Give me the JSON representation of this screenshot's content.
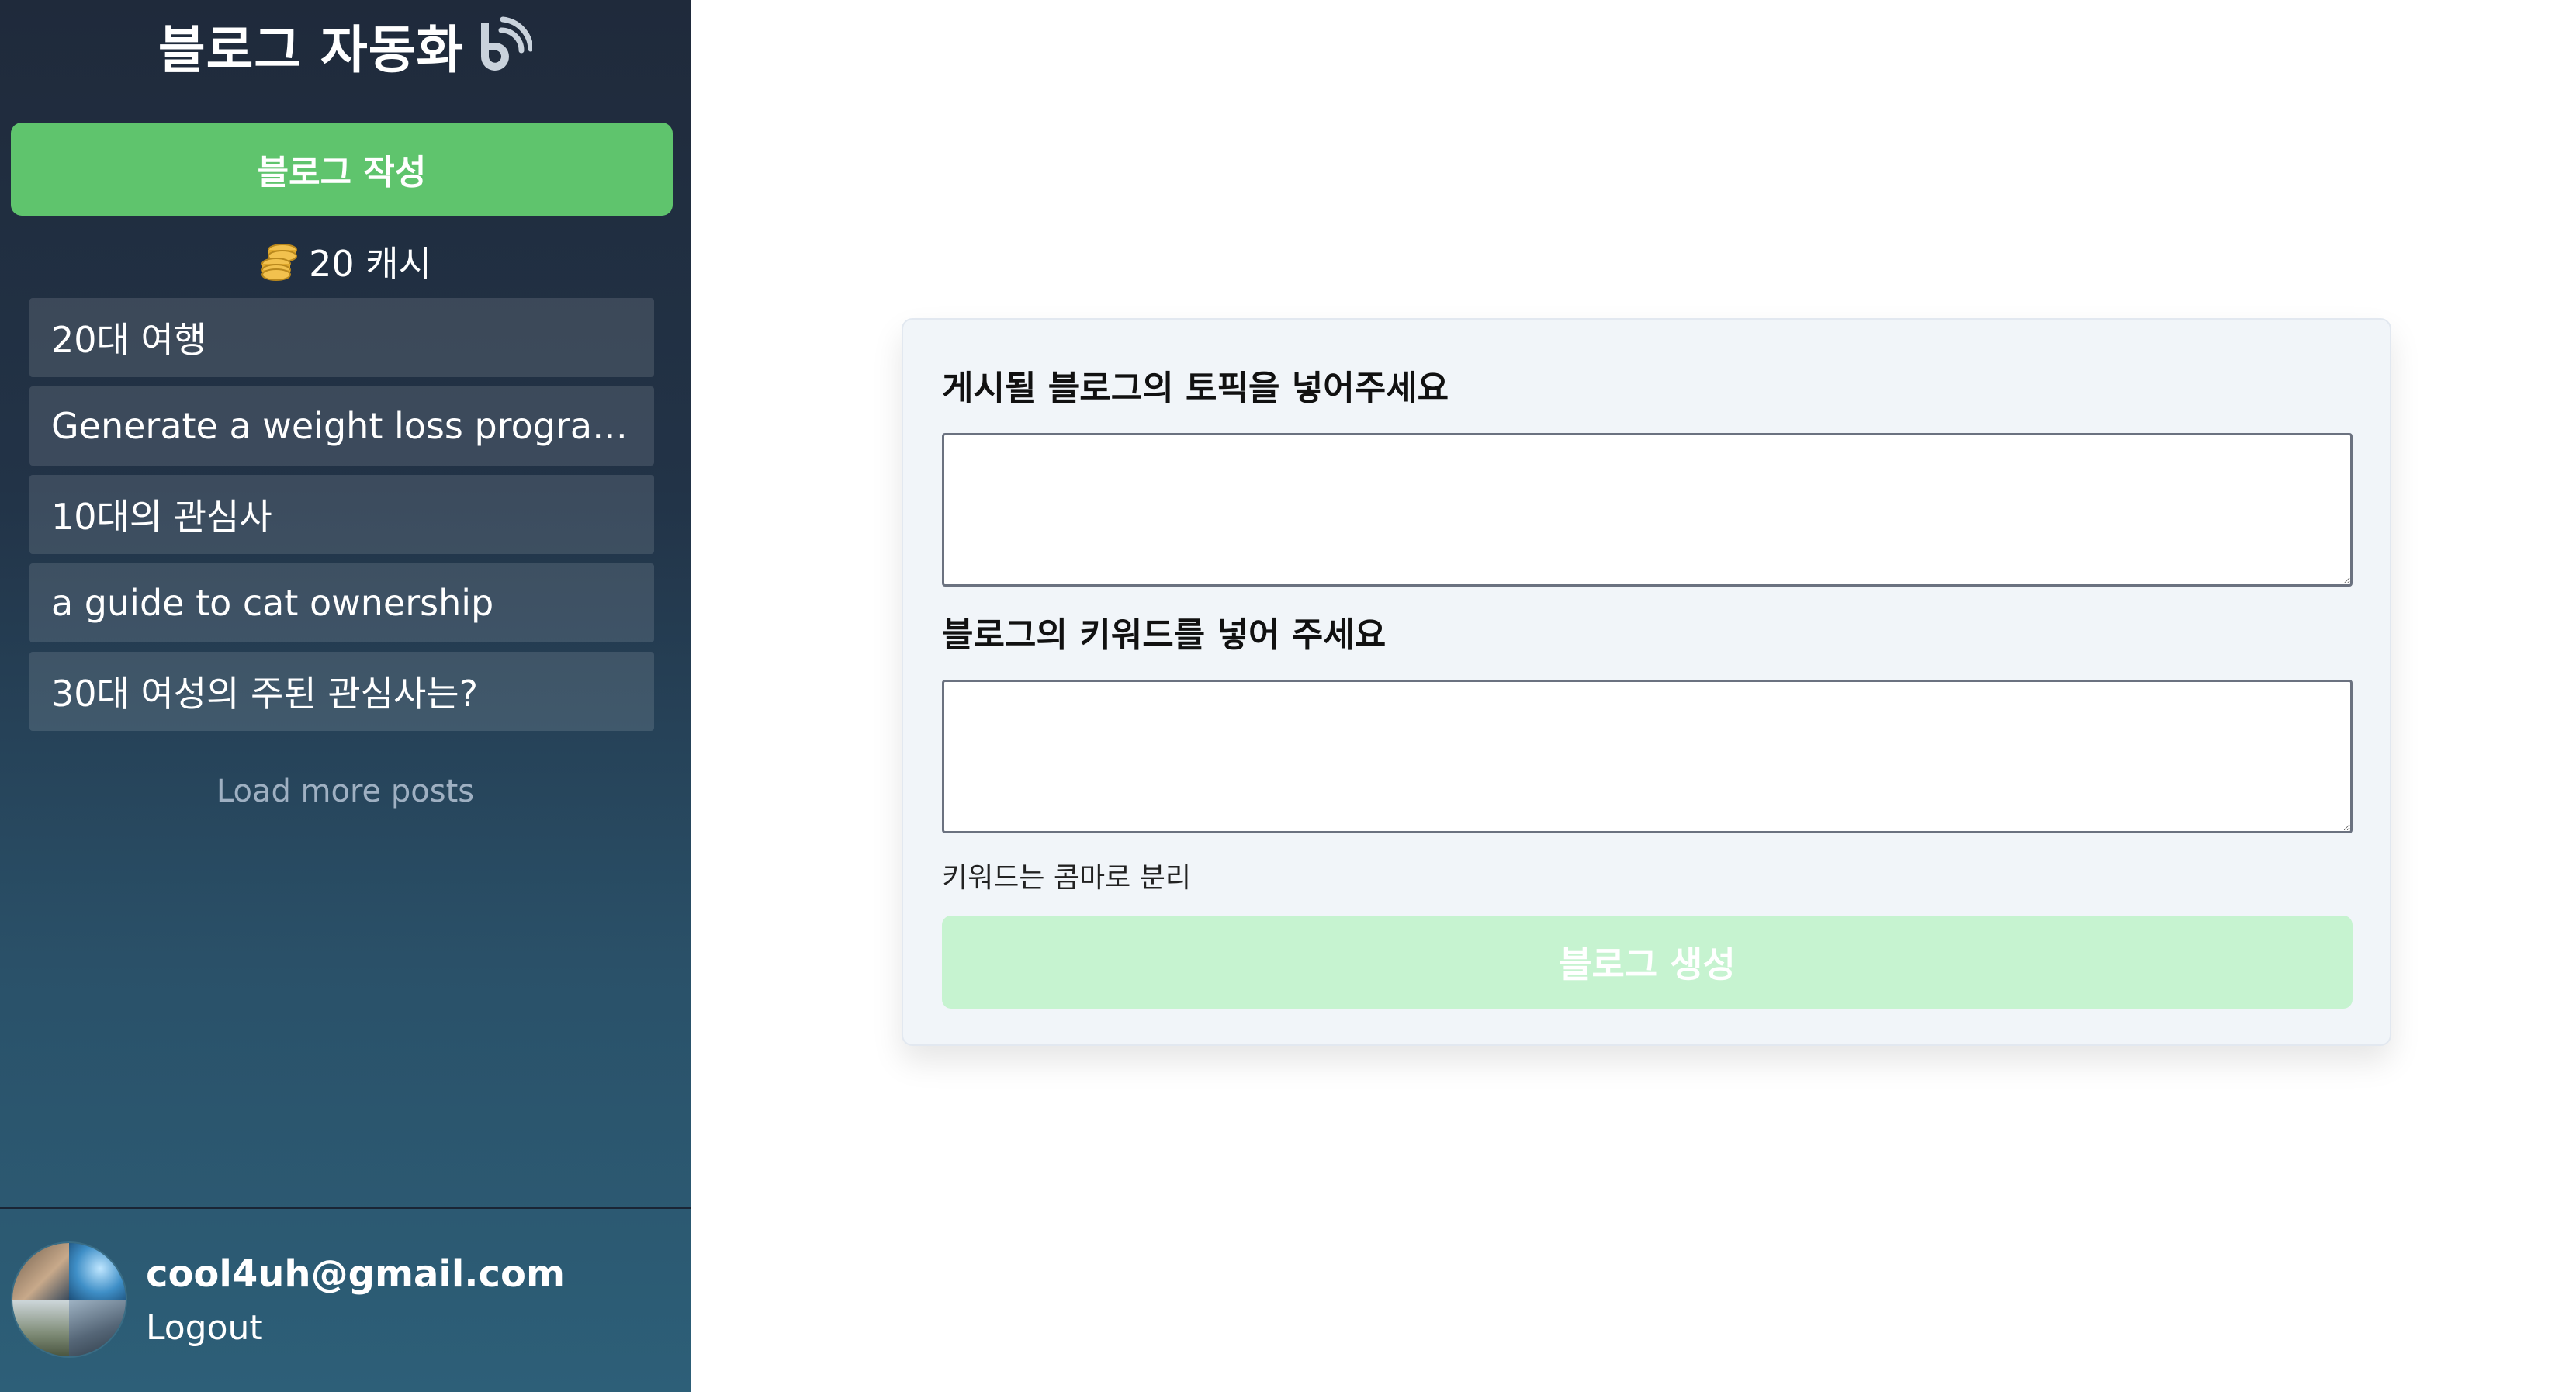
{
  "sidebar": {
    "brand_title": "블로그 자동화",
    "brand_icon": "blog-logo-icon",
    "write_button": "블로그 작성",
    "cash": {
      "icon": "coins-icon",
      "text": "20 캐시"
    },
    "posts": [
      {
        "title": "20대 여행"
      },
      {
        "title": "Generate a weight loss program ..."
      },
      {
        "title": "10대의 관심사"
      },
      {
        "title": "a guide to cat ownership"
      },
      {
        "title": "30대 여성의 주된 관심사는?"
      }
    ],
    "load_more": "Load more posts",
    "user": {
      "email": "cool4uh@gmail.com",
      "logout": "Logout"
    }
  },
  "form": {
    "topic_label": "게시될 블로그의 토픽을 넣어주세요",
    "topic_value": "",
    "keyword_label": "블로그의 키워드를 넣어 주세요",
    "keyword_value": "",
    "keyword_hint": "키워드는 콤마로 분리",
    "generate_button": "블로그 생성"
  },
  "colors": {
    "sidebar_top": "#1f2a3b",
    "sidebar_bottom": "#2d5f78",
    "primary_green": "#5fc46d",
    "disabled_green": "#c6f3d0",
    "card_bg": "#f1f5f9"
  }
}
